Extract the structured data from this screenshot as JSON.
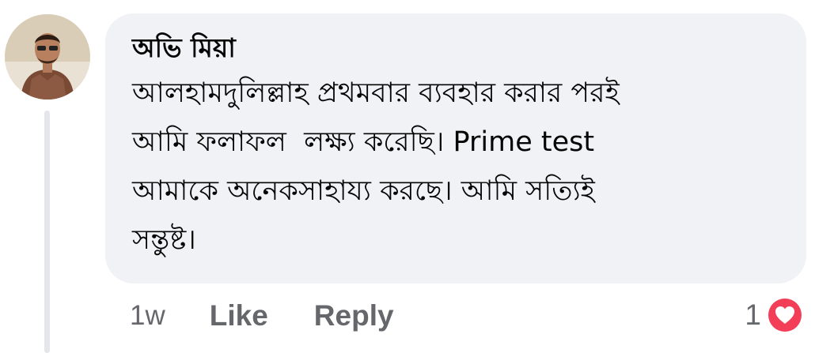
{
  "comment": {
    "author": "অভি মিয়া",
    "text": "আলহামদুলিল্লাহ প্রথমবার ব্যবহার করার পরই\nআমি ফলাফল  লক্ষ্য করেছি। Prime test\nআমাকে অনেকসাহায্য করছে। আমি সত্যিই\nসন্তুষ্ট।",
    "timestamp": "1w",
    "like_label": "Like",
    "reply_label": "Reply",
    "reaction_count": "1",
    "reaction_icon": "love-reaction-icon"
  },
  "colors": {
    "bubble_bg": "#f0f2f5",
    "secondary_text": "#65676b",
    "love_red": "#f33e58"
  }
}
